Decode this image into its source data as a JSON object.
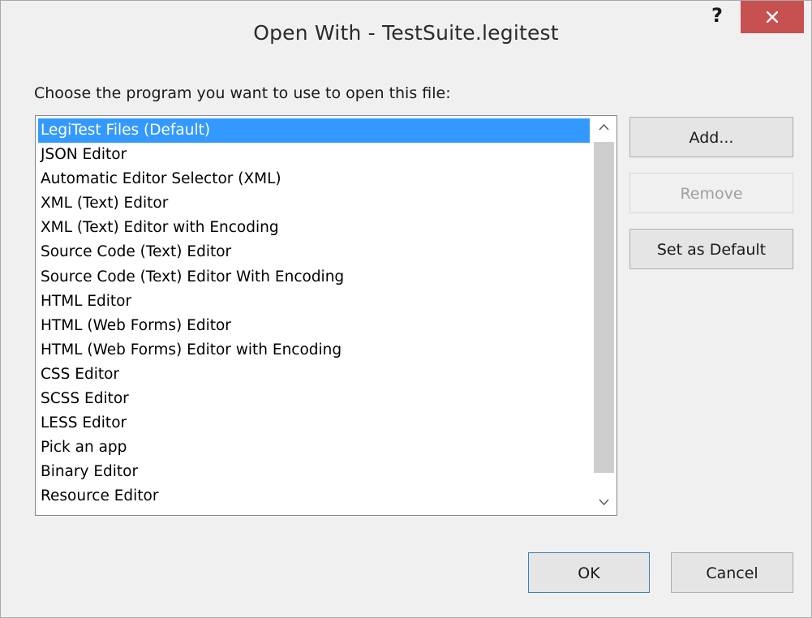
{
  "window": {
    "title": "Open With - TestSuite.legitest",
    "help_label": "?"
  },
  "prompt": "Choose the program you want to use to open this file:",
  "programs": [
    {
      "label": "LegiTest Files (Default)",
      "selected": true
    },
    {
      "label": "JSON Editor",
      "selected": false
    },
    {
      "label": "Automatic Editor Selector (XML)",
      "selected": false
    },
    {
      "label": "XML (Text) Editor",
      "selected": false
    },
    {
      "label": "XML (Text) Editor with Encoding",
      "selected": false
    },
    {
      "label": "Source Code (Text) Editor",
      "selected": false
    },
    {
      "label": "Source Code (Text) Editor With Encoding",
      "selected": false
    },
    {
      "label": "HTML Editor",
      "selected": false
    },
    {
      "label": "HTML (Web Forms) Editor",
      "selected": false
    },
    {
      "label": "HTML (Web Forms) Editor with Encoding",
      "selected": false
    },
    {
      "label": "CSS Editor",
      "selected": false
    },
    {
      "label": "SCSS Editor",
      "selected": false
    },
    {
      "label": "LESS Editor",
      "selected": false
    },
    {
      "label": "Pick an app",
      "selected": false
    },
    {
      "label": "Binary Editor",
      "selected": false
    },
    {
      "label": "Resource Editor",
      "selected": false
    }
  ],
  "buttons": {
    "add": "Add...",
    "remove": "Remove",
    "set_default": "Set as Default",
    "ok": "OK",
    "cancel": "Cancel"
  },
  "colors": {
    "selection": "#3399ff",
    "close_button": "#c75050",
    "dialog_background": "#f0f0f0"
  },
  "icons": {
    "close": "close-icon",
    "help": "help-icon",
    "scroll_up": "chevron-up-icon",
    "scroll_down": "chevron-down-icon"
  }
}
